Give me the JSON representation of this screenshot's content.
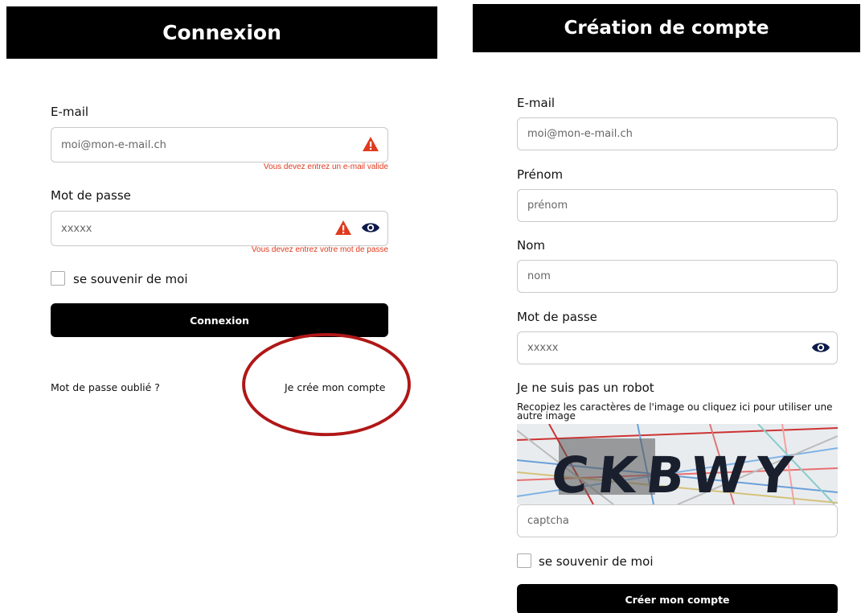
{
  "login": {
    "title": "Connexion",
    "email_label": "E-mail",
    "email_placeholder": "moi@mon-e-mail.ch",
    "email_error": "Vous devez entrez un e-mail valide",
    "password_label": "Mot de passe",
    "password_placeholder": "xxxxx",
    "password_error": "Vous devez entrez votre mot de passe",
    "remember_label": "se souvenir de moi",
    "submit_label": "Connexion",
    "forgot_link": "Mot de passe oublié ?",
    "create_link": "Je crée mon compte"
  },
  "signup": {
    "title": "Création de compte",
    "email_label": "E-mail",
    "email_placeholder": "moi@mon-e-mail.ch",
    "firstname_label": "Prénom",
    "firstname_placeholder": "prénom",
    "lastname_label": "Nom",
    "lastname_placeholder": "nom",
    "password_label": "Mot de passe",
    "password_placeholder": "xxxxx",
    "robot_title": "Je ne suis pas un robot",
    "captcha_instructions": "Recopiez les caractères de l'image ou cliquez ici pour utiliser une autre image",
    "captcha_image_text": "CKBWY",
    "captcha_placeholder": "captcha",
    "remember_label": "se souvenir de moi",
    "submit_label": "Créer mon compte"
  },
  "colors": {
    "header_bg": "#000000",
    "error": "#e03a1e",
    "eye_icon": "#0d1a4a",
    "annotation": "#b01717"
  },
  "icons": [
    "warning-icon",
    "eye-icon"
  ]
}
